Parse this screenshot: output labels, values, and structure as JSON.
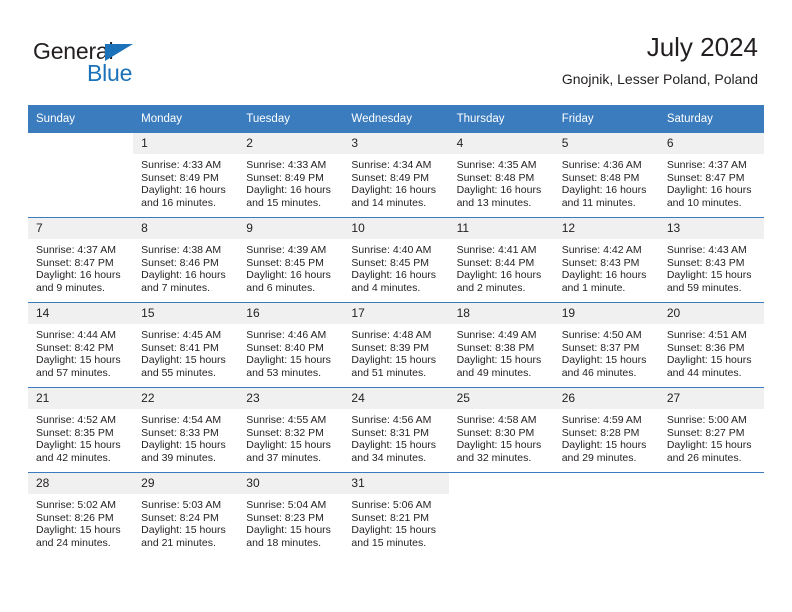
{
  "brand": {
    "name_part1": "General",
    "name_part2": "Blue",
    "accent_color": "#1b72b8"
  },
  "header": {
    "title": "July 2024",
    "subtitle": "Gnojnik, Lesser Poland, Poland"
  },
  "calendar": {
    "header_color": "#3a7cbe",
    "daynum_bg": "#f0f0f0",
    "weekdays": [
      "Sunday",
      "Monday",
      "Tuesday",
      "Wednesday",
      "Thursday",
      "Friday",
      "Saturday"
    ],
    "weeks": [
      [
        {
          "day": "",
          "blank": true,
          "lines": []
        },
        {
          "day": "1",
          "lines": [
            "Sunrise: 4:33 AM",
            "Sunset: 8:49 PM",
            "Daylight: 16 hours",
            "and 16 minutes."
          ]
        },
        {
          "day": "2",
          "lines": [
            "Sunrise: 4:33 AM",
            "Sunset: 8:49 PM",
            "Daylight: 16 hours",
            "and 15 minutes."
          ]
        },
        {
          "day": "3",
          "lines": [
            "Sunrise: 4:34 AM",
            "Sunset: 8:49 PM",
            "Daylight: 16 hours",
            "and 14 minutes."
          ]
        },
        {
          "day": "4",
          "lines": [
            "Sunrise: 4:35 AM",
            "Sunset: 8:48 PM",
            "Daylight: 16 hours",
            "and 13 minutes."
          ]
        },
        {
          "day": "5",
          "lines": [
            "Sunrise: 4:36 AM",
            "Sunset: 8:48 PM",
            "Daylight: 16 hours",
            "and 11 minutes."
          ]
        },
        {
          "day": "6",
          "lines": [
            "Sunrise: 4:37 AM",
            "Sunset: 8:47 PM",
            "Daylight: 16 hours",
            "and 10 minutes."
          ]
        }
      ],
      [
        {
          "day": "7",
          "lines": [
            "Sunrise: 4:37 AM",
            "Sunset: 8:47 PM",
            "Daylight: 16 hours",
            "and 9 minutes."
          ]
        },
        {
          "day": "8",
          "lines": [
            "Sunrise: 4:38 AM",
            "Sunset: 8:46 PM",
            "Daylight: 16 hours",
            "and 7 minutes."
          ]
        },
        {
          "day": "9",
          "lines": [
            "Sunrise: 4:39 AM",
            "Sunset: 8:45 PM",
            "Daylight: 16 hours",
            "and 6 minutes."
          ]
        },
        {
          "day": "10",
          "lines": [
            "Sunrise: 4:40 AM",
            "Sunset: 8:45 PM",
            "Daylight: 16 hours",
            "and 4 minutes."
          ]
        },
        {
          "day": "11",
          "lines": [
            "Sunrise: 4:41 AM",
            "Sunset: 8:44 PM",
            "Daylight: 16 hours",
            "and 2 minutes."
          ]
        },
        {
          "day": "12",
          "lines": [
            "Sunrise: 4:42 AM",
            "Sunset: 8:43 PM",
            "Daylight: 16 hours",
            "and 1 minute."
          ]
        },
        {
          "day": "13",
          "lines": [
            "Sunrise: 4:43 AM",
            "Sunset: 8:43 PM",
            "Daylight: 15 hours",
            "and 59 minutes."
          ]
        }
      ],
      [
        {
          "day": "14",
          "lines": [
            "Sunrise: 4:44 AM",
            "Sunset: 8:42 PM",
            "Daylight: 15 hours",
            "and 57 minutes."
          ]
        },
        {
          "day": "15",
          "lines": [
            "Sunrise: 4:45 AM",
            "Sunset: 8:41 PM",
            "Daylight: 15 hours",
            "and 55 minutes."
          ]
        },
        {
          "day": "16",
          "lines": [
            "Sunrise: 4:46 AM",
            "Sunset: 8:40 PM",
            "Daylight: 15 hours",
            "and 53 minutes."
          ]
        },
        {
          "day": "17",
          "lines": [
            "Sunrise: 4:48 AM",
            "Sunset: 8:39 PM",
            "Daylight: 15 hours",
            "and 51 minutes."
          ]
        },
        {
          "day": "18",
          "lines": [
            "Sunrise: 4:49 AM",
            "Sunset: 8:38 PM",
            "Daylight: 15 hours",
            "and 49 minutes."
          ]
        },
        {
          "day": "19",
          "lines": [
            "Sunrise: 4:50 AM",
            "Sunset: 8:37 PM",
            "Daylight: 15 hours",
            "and 46 minutes."
          ]
        },
        {
          "day": "20",
          "lines": [
            "Sunrise: 4:51 AM",
            "Sunset: 8:36 PM",
            "Daylight: 15 hours",
            "and 44 minutes."
          ]
        }
      ],
      [
        {
          "day": "21",
          "lines": [
            "Sunrise: 4:52 AM",
            "Sunset: 8:35 PM",
            "Daylight: 15 hours",
            "and 42 minutes."
          ]
        },
        {
          "day": "22",
          "lines": [
            "Sunrise: 4:54 AM",
            "Sunset: 8:33 PM",
            "Daylight: 15 hours",
            "and 39 minutes."
          ]
        },
        {
          "day": "23",
          "lines": [
            "Sunrise: 4:55 AM",
            "Sunset: 8:32 PM",
            "Daylight: 15 hours",
            "and 37 minutes."
          ]
        },
        {
          "day": "24",
          "lines": [
            "Sunrise: 4:56 AM",
            "Sunset: 8:31 PM",
            "Daylight: 15 hours",
            "and 34 minutes."
          ]
        },
        {
          "day": "25",
          "lines": [
            "Sunrise: 4:58 AM",
            "Sunset: 8:30 PM",
            "Daylight: 15 hours",
            "and 32 minutes."
          ]
        },
        {
          "day": "26",
          "lines": [
            "Sunrise: 4:59 AM",
            "Sunset: 8:28 PM",
            "Daylight: 15 hours",
            "and 29 minutes."
          ]
        },
        {
          "day": "27",
          "lines": [
            "Sunrise: 5:00 AM",
            "Sunset: 8:27 PM",
            "Daylight: 15 hours",
            "and 26 minutes."
          ]
        }
      ],
      [
        {
          "day": "28",
          "lines": [
            "Sunrise: 5:02 AM",
            "Sunset: 8:26 PM",
            "Daylight: 15 hours",
            "and 24 minutes."
          ]
        },
        {
          "day": "29",
          "lines": [
            "Sunrise: 5:03 AM",
            "Sunset: 8:24 PM",
            "Daylight: 15 hours",
            "and 21 minutes."
          ]
        },
        {
          "day": "30",
          "lines": [
            "Sunrise: 5:04 AM",
            "Sunset: 8:23 PM",
            "Daylight: 15 hours",
            "and 18 minutes."
          ]
        },
        {
          "day": "31",
          "lines": [
            "Sunrise: 5:06 AM",
            "Sunset: 8:21 PM",
            "Daylight: 15 hours",
            "and 15 minutes."
          ]
        },
        {
          "day": "",
          "blank": true,
          "lines": []
        },
        {
          "day": "",
          "blank": true,
          "lines": []
        },
        {
          "day": "",
          "blank": true,
          "lines": []
        }
      ]
    ]
  }
}
